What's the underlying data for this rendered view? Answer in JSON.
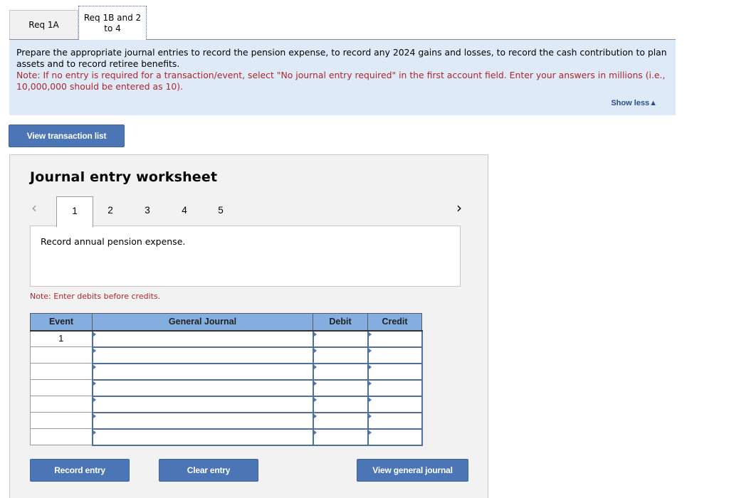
{
  "tabs": [
    {
      "label": "Req 1A",
      "active": false
    },
    {
      "label": "Req 1B and 2 to 4",
      "line1": "Req 1B and 2",
      "line2": "to 4",
      "active": true
    }
  ],
  "instructions": {
    "main": "Prepare the appropriate journal entries to record the pension expense, to record any 2024 gains and losses, to record the cash contribution to plan assets and to record retiree benefits.",
    "note": "Note: If no entry is required for a transaction/event, select \"No journal entry required\" in the first account field. Enter your answers in millions (i.e., 10,000,000 should be entered as 10).",
    "show_less": "Show less",
    "show_less_icon": "▲"
  },
  "buttons": {
    "view_transaction_list": "View transaction list",
    "record_entry": "Record entry",
    "clear_entry": "Clear entry",
    "view_general_journal": "View general journal"
  },
  "worksheet": {
    "title": "Journal entry worksheet",
    "prev_icon": "‹",
    "next_icon": "›",
    "steps": [
      "1",
      "2",
      "3",
      "4",
      "5"
    ],
    "active_step": "1",
    "description": "Record annual pension expense.",
    "debit_note": "Note: Enter debits before credits."
  },
  "table": {
    "headers": {
      "event": "Event",
      "general_journal": "General Journal",
      "debit": "Debit",
      "credit": "Credit"
    },
    "rows": [
      {
        "event": "1",
        "account": "",
        "debit": "",
        "credit": ""
      },
      {
        "event": "",
        "account": "",
        "debit": "",
        "credit": ""
      },
      {
        "event": "",
        "account": "",
        "debit": "",
        "credit": ""
      },
      {
        "event": "",
        "account": "",
        "debit": "",
        "credit": ""
      },
      {
        "event": "",
        "account": "",
        "debit": "",
        "credit": ""
      },
      {
        "event": "",
        "account": "",
        "debit": "",
        "credit": ""
      },
      {
        "event": "",
        "account": "",
        "debit": "",
        "credit": ""
      }
    ]
  }
}
